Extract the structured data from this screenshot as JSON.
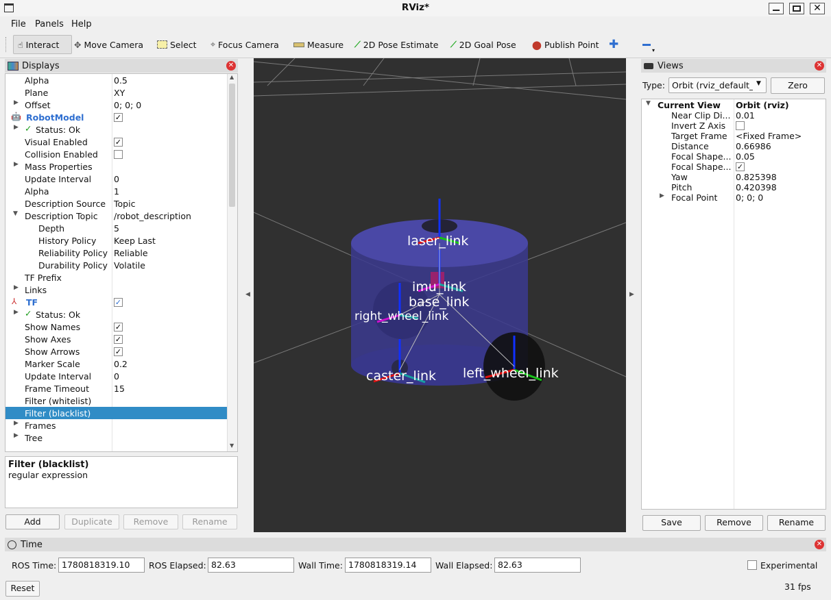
{
  "window": {
    "title": "RViz*"
  },
  "menu": [
    "File",
    "Panels",
    "Help"
  ],
  "toolbar": [
    {
      "label": "Interact",
      "icon": "cursor-hand-icon"
    },
    {
      "label": "Move Camera",
      "icon": "move-camera-icon"
    },
    {
      "label": "Select",
      "icon": "select-box-icon"
    },
    {
      "label": "Focus Camera",
      "icon": "focus-target-icon"
    },
    {
      "label": "Measure",
      "icon": "ruler-icon"
    },
    {
      "label": "2D Pose Estimate",
      "icon": "green-arrow-icon"
    },
    {
      "label": "2D Goal Pose",
      "icon": "green-arrow-icon"
    },
    {
      "label": "Publish Point",
      "icon": "map-pin-icon"
    }
  ],
  "displays": {
    "title": "Displays",
    "rows": [
      {
        "key": "Alpha",
        "value": "0.5"
      },
      {
        "key": "Plane",
        "value": "XY"
      },
      {
        "key": "Offset",
        "value": "0; 0; 0"
      },
      {
        "key": "RobotModel",
        "value": ""
      },
      {
        "key": "Status: Ok",
        "value": ""
      },
      {
        "key": "Visual Enabled",
        "value": ""
      },
      {
        "key": "Collision Enabled",
        "value": ""
      },
      {
        "key": "Mass Properties",
        "value": ""
      },
      {
        "key": "Update Interval",
        "value": "0"
      },
      {
        "key": "Alpha",
        "value": "1"
      },
      {
        "key": "Description Source",
        "value": "Topic"
      },
      {
        "key": "Description Topic",
        "value": "/robot_description"
      },
      {
        "key": "Depth",
        "value": "5"
      },
      {
        "key": "History Policy",
        "value": "Keep Last"
      },
      {
        "key": "Reliability Policy",
        "value": "Reliable"
      },
      {
        "key": "Durability Policy",
        "value": "Volatile"
      },
      {
        "key": "TF Prefix",
        "value": ""
      },
      {
        "key": "Links",
        "value": ""
      },
      {
        "key": "TF",
        "value": ""
      },
      {
        "key": "Status: Ok",
        "value": ""
      },
      {
        "key": "Show Names",
        "value": ""
      },
      {
        "key": "Show Axes",
        "value": ""
      },
      {
        "key": "Show Arrows",
        "value": ""
      },
      {
        "key": "Marker Scale",
        "value": "0.2"
      },
      {
        "key": "Update Interval",
        "value": "0"
      },
      {
        "key": "Frame Timeout",
        "value": "15"
      },
      {
        "key": "Filter (whitelist)",
        "value": ""
      },
      {
        "key": "Filter (blacklist)",
        "value": ""
      },
      {
        "key": "Frames",
        "value": ""
      },
      {
        "key": "Tree",
        "value": ""
      }
    ],
    "description": {
      "title": "Filter (blacklist)",
      "text": "regular expression"
    },
    "buttons": {
      "add": "Add",
      "duplicate": "Duplicate",
      "remove": "Remove",
      "rename": "Rename"
    }
  },
  "viewport": {
    "frame_labels": [
      "laser_link",
      "imu_link",
      "base_link",
      "right_wheel_link",
      "caster_link",
      "left_wheel_link"
    ]
  },
  "views": {
    "title": "Views",
    "type_label": "Type:",
    "type_value": "Orbit (rviz_default_p",
    "zero": "Zero",
    "header": {
      "key": "Current View",
      "value": "Orbit (rviz)"
    },
    "rows": [
      {
        "key": "Near Clip Di...",
        "value": "0.01"
      },
      {
        "key": "Invert Z Axis",
        "value": ""
      },
      {
        "key": "Target Frame",
        "value": "<Fixed Frame>"
      },
      {
        "key": "Distance",
        "value": "0.66986"
      },
      {
        "key": "Focal Shape...",
        "value": "0.05"
      },
      {
        "key": "Focal Shape...",
        "value": ""
      },
      {
        "key": "Yaw",
        "value": "0.825398"
      },
      {
        "key": "Pitch",
        "value": "0.420398"
      },
      {
        "key": "Focal Point",
        "value": "0; 0; 0"
      }
    ],
    "buttons": {
      "save": "Save",
      "remove": "Remove",
      "rename": "Rename"
    }
  },
  "time": {
    "title": "Time",
    "ros_time_label": "ROS Time:",
    "ros_time": "1780818319.10",
    "ros_elapsed_label": "ROS Elapsed:",
    "ros_elapsed": "82.63",
    "wall_time_label": "Wall Time:",
    "wall_time": "1780818319.14",
    "wall_elapsed_label": "Wall Elapsed:",
    "wall_elapsed": "82.63",
    "experimental": "Experimental",
    "reset": "Reset",
    "fps": "31 fps"
  }
}
